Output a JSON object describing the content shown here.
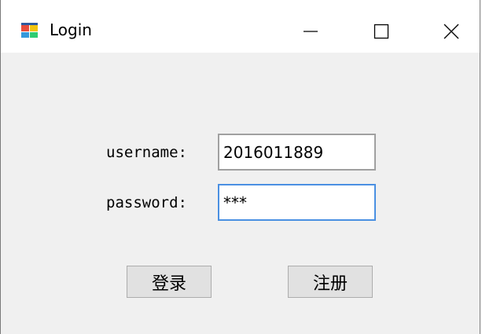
{
  "window": {
    "title": "Login",
    "icon": "windows-form-icon",
    "controls": {
      "minimize_icon": "minimize-icon",
      "maximize_icon": "maximize-icon",
      "close_icon": "close-icon"
    }
  },
  "form": {
    "username_label": "username:",
    "username_value": "2016011889",
    "password_label": "password:",
    "password_value": "***",
    "login_button": "登录",
    "register_button": "注册"
  },
  "colors": {
    "client_background": "#f0f0f0",
    "focus_border": "#4a90e2",
    "button_face": "#e1e1e1"
  }
}
